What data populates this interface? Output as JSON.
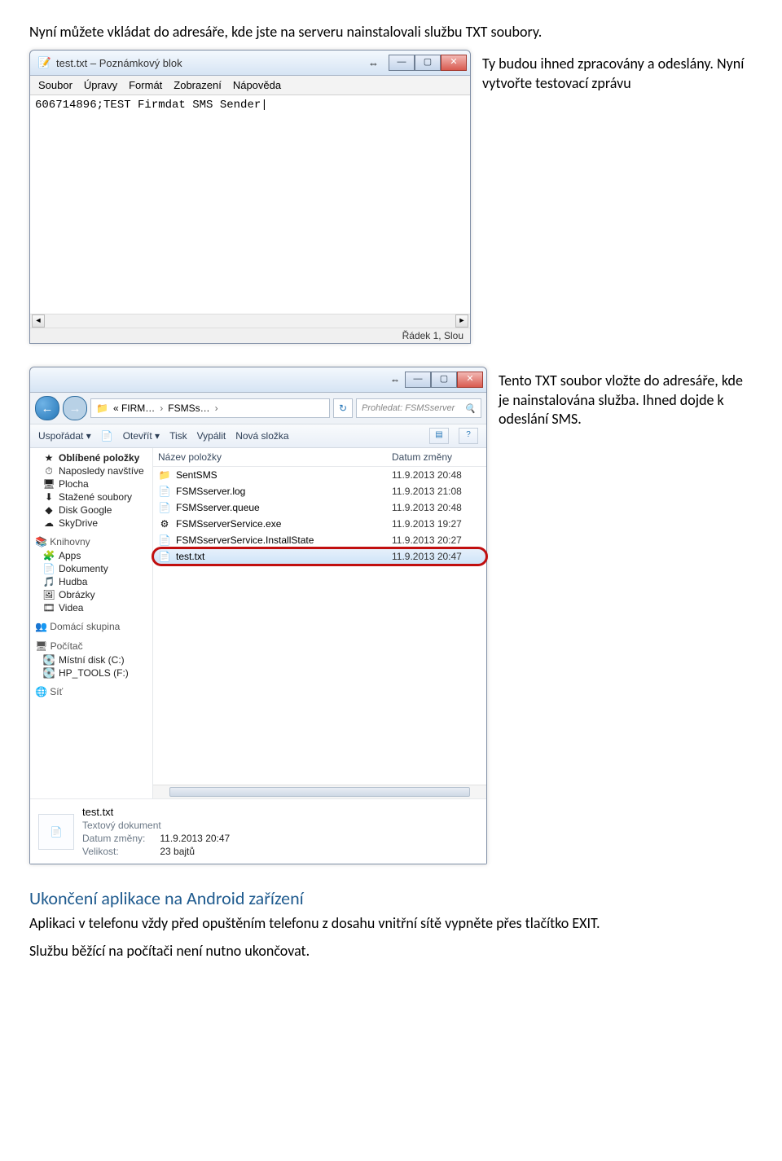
{
  "intro_para": "Nyní můžete vkládat do adresáře, kde jste na serveru nainstalovali službu TXT soubory.",
  "side1": "Ty budou ihned zpracovány a odeslány. Nyní vytvořte testovací zprávu",
  "side2": "Tento TXT soubor vložte do adresáře, kde je nainstalována služba. Ihned dojde k odeslání SMS.",
  "section_title": "Ukončení aplikace na Android zařízení",
  "para_end1": "Aplikaci v telefonu vždy před opuštěním telefonu z dosahu vnitřní sítě vypněte přes tlačítko EXIT.",
  "para_end2": "Službu běžící na počítači není nutno ukončovat.",
  "notepad": {
    "title": "test.txt – Poznámkový blok",
    "arrows": "⇔",
    "min": "—",
    "max": "▢",
    "close": "✕",
    "menu": [
      "Soubor",
      "Úpravy",
      "Formát",
      "Zobrazení",
      "Nápověda"
    ],
    "content": "606714896;TEST Firmdat SMS Sender|",
    "scroll_left": "◄",
    "scroll_right": "►",
    "status": "Řádek 1, Slou"
  },
  "explorer": {
    "nav_back_glyph": "←",
    "nav_fwd_glyph": "→",
    "crumb1": "« FIRM…",
    "crumb2": "FSMSs…",
    "crumb_sep": "›",
    "refresh_glyph": "↻",
    "search_placeholder": "Prohledat: FSMSserver",
    "search_glyph": "🔍",
    "toolbar": {
      "organize": "Uspořádat ▾",
      "open": "Otevřít ▾",
      "print": "Tisk",
      "burn": "Vypálit",
      "new_folder": "Nová složka",
      "view_glyph": "▤",
      "help_glyph": "?"
    },
    "tree": {
      "fav_label": "Oblíbené položky",
      "fav_items": [
        {
          "icon": "⏱",
          "label": "Naposledy navštíve"
        },
        {
          "icon": "🖥",
          "label": "Plocha"
        },
        {
          "icon": "⬇",
          "label": "Stažené soubory"
        },
        {
          "icon": "◆",
          "label": "Disk Google"
        },
        {
          "icon": "☁",
          "label": "SkyDrive"
        }
      ],
      "lib_label": "Knihovny",
      "lib_items": [
        {
          "icon": "🧩",
          "label": "Apps"
        },
        {
          "icon": "📄",
          "label": "Dokumenty"
        },
        {
          "icon": "🎵",
          "label": "Hudba"
        },
        {
          "icon": "🖼",
          "label": "Obrázky"
        },
        {
          "icon": "🎞",
          "label": "Videa"
        }
      ],
      "home_label": "Domácí skupina",
      "pc_label": "Počítač",
      "pc_items": [
        {
          "icon": "💽",
          "label": "Místní disk (C:)"
        },
        {
          "icon": "💽",
          "label": "HP_TOOLS (F:)"
        }
      ],
      "net_label": "Síť"
    },
    "columns": {
      "name": "Název položky",
      "date": "Datum změny"
    },
    "files": [
      {
        "icon": "📁",
        "name": "SentSMS",
        "date": "11.9.2013 20:48"
      },
      {
        "icon": "📄",
        "name": "FSMSserver.log",
        "date": "11.9.2013 21:08"
      },
      {
        "icon": "📄",
        "name": "FSMSserver.queue",
        "date": "11.9.2013 20:48"
      },
      {
        "icon": "⚙",
        "name": "FSMSserverService.exe",
        "date": "11.9.2013 19:27"
      },
      {
        "icon": "📄",
        "name": "FSMSserverService.InstallState",
        "date": "11.9.2013 20:27"
      },
      {
        "icon": "📄",
        "name": "test.txt",
        "date": "11.9.2013 20:47"
      }
    ],
    "details": {
      "name": "test.txt",
      "type": "Textový dokument",
      "mod_label": "Datum změny:",
      "mod_value": "11.9.2013 20:47",
      "size_label": "Velikost:",
      "size_value": "23 bajtů"
    },
    "min": "—",
    "max": "▢",
    "close": "✕"
  }
}
